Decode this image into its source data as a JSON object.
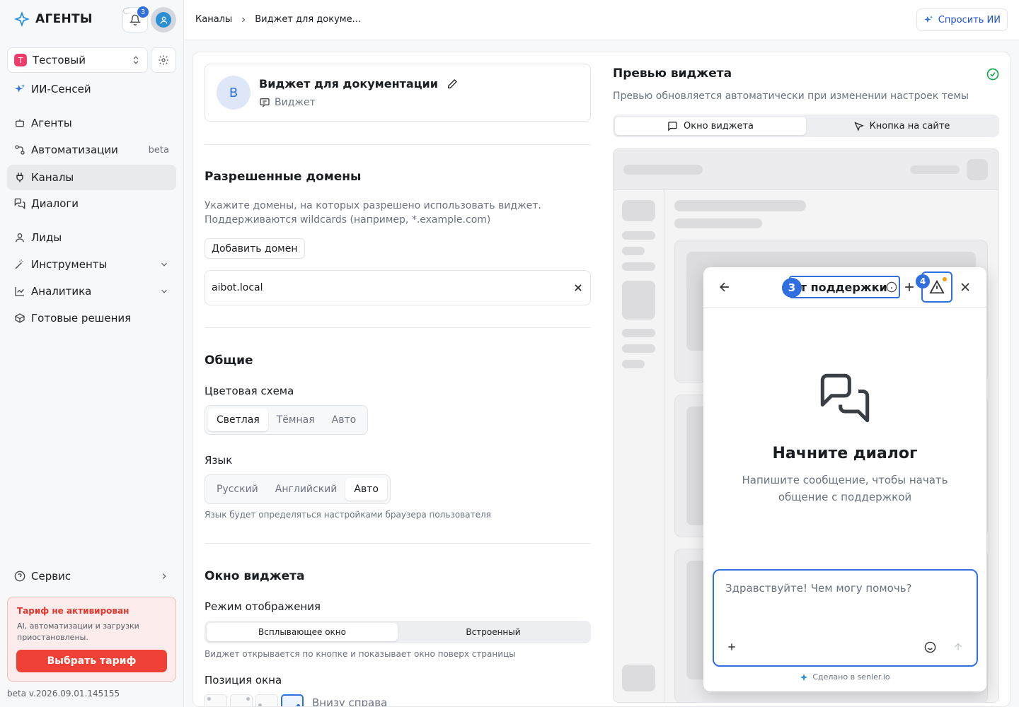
{
  "app": {
    "logo_text": "АГЕНТЫ",
    "notifications_count": "3",
    "workspace_badge": "Т",
    "workspace_name": "Тестовый",
    "accent": "#2f6fe0",
    "danger": "#ef4136"
  },
  "sidebar": {
    "items": [
      {
        "label": "ИИ-Сенсей"
      },
      {
        "label": "Агенты"
      },
      {
        "label": "Автоматизации",
        "badge": "beta"
      },
      {
        "label": "Каналы"
      },
      {
        "label": "Диалоги"
      },
      {
        "label": "Лиды"
      },
      {
        "label": "Инструменты"
      },
      {
        "label": "Аналитика"
      },
      {
        "label": "Готовые решения"
      },
      {
        "label": "Сервис"
      }
    ],
    "tariff": {
      "title": "Тариф не активирован",
      "text": "AI, автоматизации и загрузки приостановлены.",
      "button": "Выбрать тариф"
    },
    "version": "beta v.2026.09.01.145155"
  },
  "topbar": {
    "breadcrumbs": [
      "Каналы",
      "Виджет для докуме..."
    ],
    "ask_ai": "Спросить ИИ"
  },
  "widget": {
    "avatar_letter": "В",
    "name": "Виджет для документации",
    "type": "Виджет"
  },
  "domains": {
    "title": "Разрешенные домены",
    "desc1": "Укажите домены, на которых разрешено использовать виджет.",
    "desc2": "Поддерживаются wildcards (например, *.example.com)",
    "add_button": "Добавить домен",
    "items": [
      "aibot.local"
    ]
  },
  "general": {
    "title": "Общие",
    "color_scheme_label": "Цветовая схема",
    "color_scheme_options": [
      "Светлая",
      "Тёмная",
      "Авто"
    ],
    "language_label": "Язык",
    "language_options": [
      "Русский",
      "Английский",
      "Авто"
    ],
    "language_hint": "Язык будет определяться настройками браузера пользователя"
  },
  "window": {
    "title": "Окно виджета",
    "mode_label": "Режим отображения",
    "mode_options": [
      "Всплывающее окно",
      "Встроенный"
    ],
    "mode_hint": "Виджет открывается по кнопке и показывает окно поверх страницы",
    "position_label": "Позиция окна",
    "position_value": "Внизу справа"
  },
  "preview": {
    "title": "Превью виджета",
    "subtitle": "Превью обновляется автоматически при изменении настроек темы",
    "tabs": [
      "Окно виджета",
      "Кнопка на сайте"
    ],
    "chat": {
      "title": "Чат поддержки",
      "badge_title": "3",
      "badge_warn": "4",
      "empty_title": "Начните диалог",
      "empty_sub": "Напишите сообщение, чтобы начать общение с поддержкой",
      "input_placeholder": "Здравствуйте! Чем могу помочь?",
      "made_by": "Сделано в senler.io"
    }
  }
}
